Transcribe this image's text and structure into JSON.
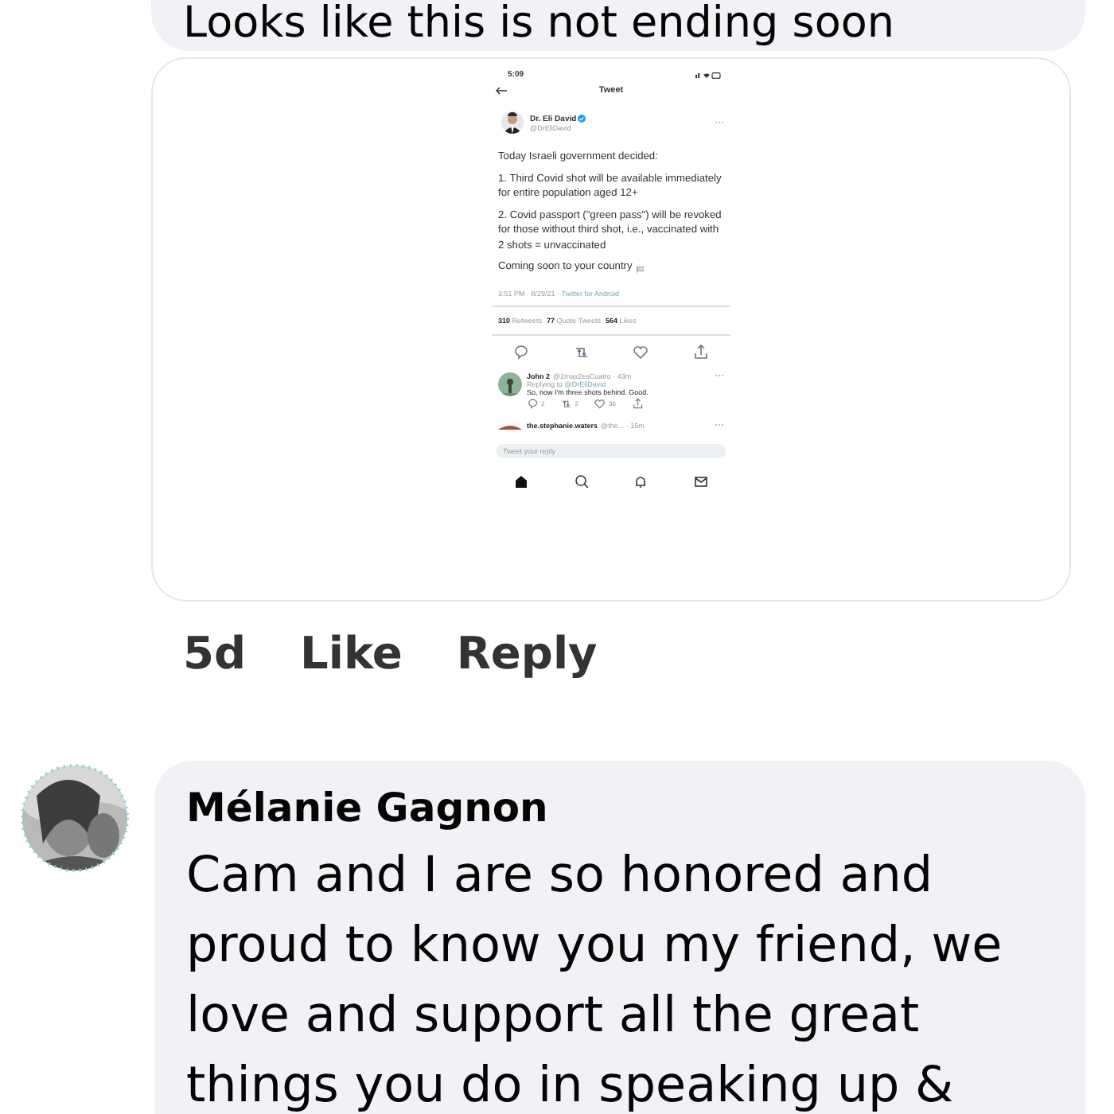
{
  "comments": [
    {
      "text": "Looks like this is not ending soon",
      "attachment": {
        "kind": "screenshot",
        "status_time": "5:09",
        "header_title": "Tweet",
        "author": {
          "name": "Dr. Eli David",
          "handle": "@DrEliDavid",
          "verified": true
        },
        "paragraphs": [
          "Today Israeli government decided:",
          "1. Third Covid shot will be available immediately for entire population aged 12+",
          "2. Covid passport (\"green pass\") will be revoked for those without third shot, i.e., vaccinated with 2 shots = unvaccinated",
          "Coming soon to your country"
        ],
        "meta": "3:51 PM · 8/29/21 · ",
        "meta_link": "Twitter for Android",
        "stats": [
          {
            "count": "310",
            "label": "Retweets"
          },
          {
            "count": "77",
            "label": "Quote Tweets"
          },
          {
            "count": "564",
            "label": "Likes"
          }
        ],
        "replies": [
          {
            "name": "John 2",
            "handle": "@2max2esCuatro · 43m",
            "replying_to": "Replying to ",
            "replying_handle": "@DrEliDavid",
            "text": "So, now I'm three shots behind. Good.",
            "counts": [
              "2",
              "2",
              "36"
            ]
          },
          {
            "name": "the.stephanie.waters",
            "handle": "@the... · 15m"
          }
        ],
        "reply_placeholder": "Tweet your reply"
      },
      "age": "5d",
      "actions": [
        "Like",
        "Reply"
      ]
    },
    {
      "author": "Mélanie Gagnon",
      "text": "Cam and I are so honored and proud to know you my friend, we love and support all the great things you do in speaking up &"
    }
  ]
}
